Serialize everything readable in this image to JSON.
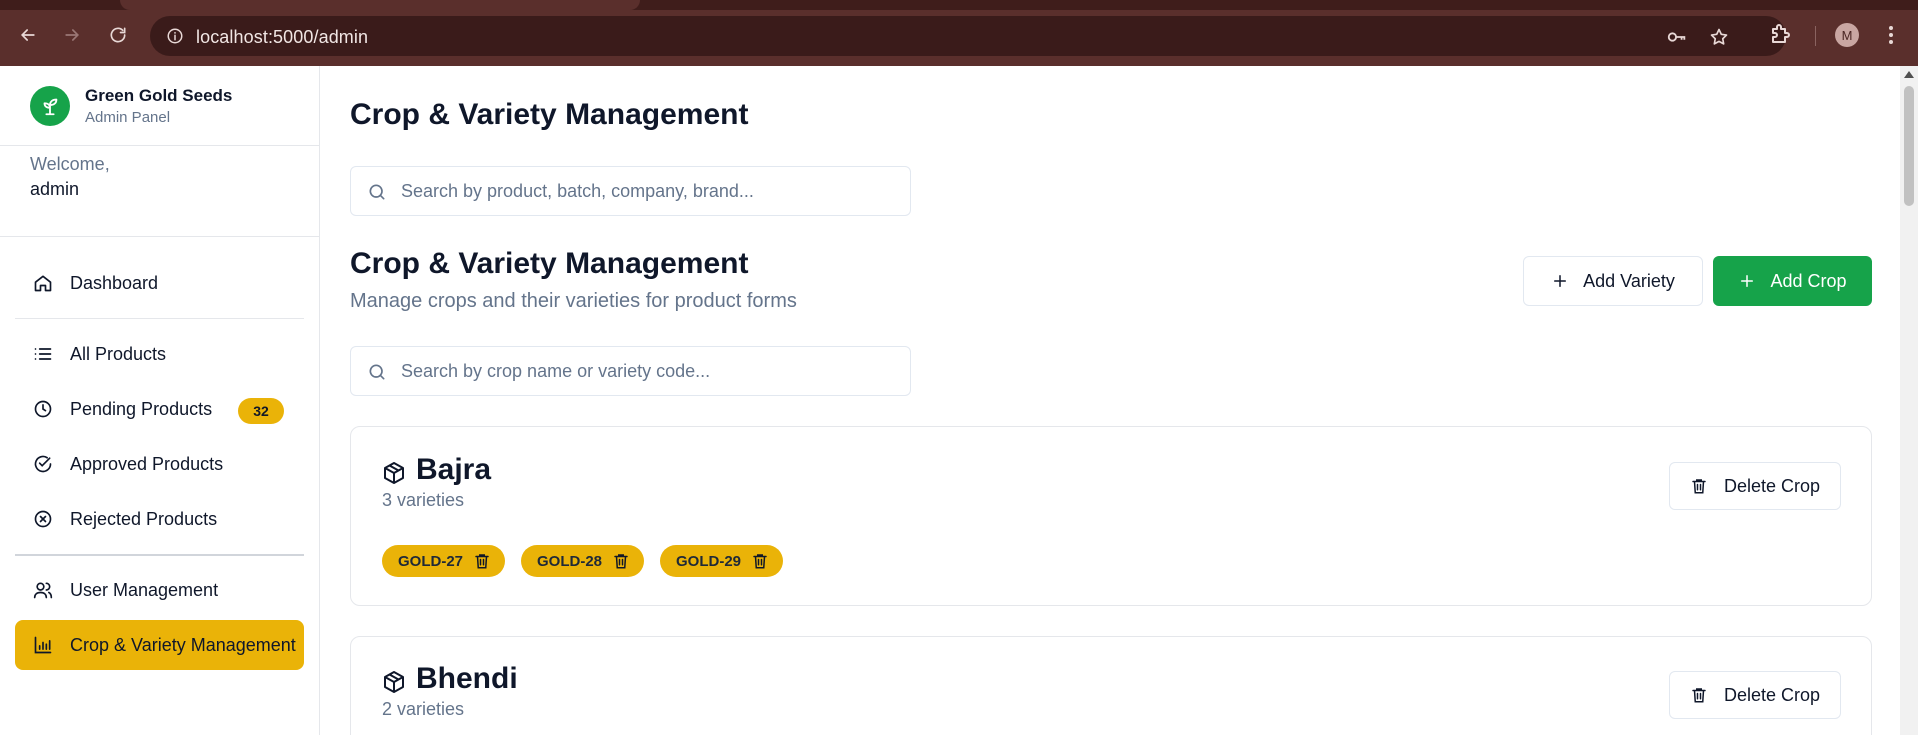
{
  "browser": {
    "url": "localhost:5000/admin",
    "profile_initial": "M",
    "icons": [
      "back-icon",
      "forward-icon",
      "reload-icon",
      "site-info-icon",
      "key-icon",
      "star-icon",
      "extensions-icon",
      "menu-dots-icon"
    ]
  },
  "sidebar": {
    "brand_name": "Green Gold Seeds",
    "brand_sub": "Admin Panel",
    "welcome_label": "Welcome,",
    "username": "admin",
    "items": [
      {
        "label": "Dashboard",
        "icon": "home-icon"
      },
      {
        "label": "All Products",
        "icon": "list-icon"
      },
      {
        "label": "Pending Products",
        "icon": "clock-icon",
        "badge": "32"
      },
      {
        "label": "Approved Products",
        "icon": "check-circle-icon"
      },
      {
        "label": "Rejected Products",
        "icon": "x-circle-icon"
      },
      {
        "label": "User Management",
        "icon": "users-icon"
      },
      {
        "label": "Crop & Variety Management",
        "icon": "bar-chart-icon",
        "active": true
      }
    ]
  },
  "main": {
    "page_title": "Crop & Variety Management",
    "top_search_placeholder": "Search by product, batch, company, brand...",
    "section_title": "Crop & Variety Management",
    "section_subtitle": "Manage crops and their varieties for product forms",
    "add_variety_label": "Add Variety",
    "add_crop_label": "Add Crop",
    "crop_search_placeholder": "Search by crop name or variety code...",
    "delete_crop_label": "Delete Crop",
    "crops": [
      {
        "name": "Bajra",
        "count": "3 varieties",
        "varieties": [
          "GOLD-27",
          "GOLD-28",
          "GOLD-29"
        ]
      },
      {
        "name": "Bhendi",
        "count": "2 varieties",
        "varieties": []
      }
    ]
  },
  "colors": {
    "accent_yellow": "#eab308",
    "brand_green": "#16a34a",
    "chrome_bg": "#5a2f2c"
  }
}
